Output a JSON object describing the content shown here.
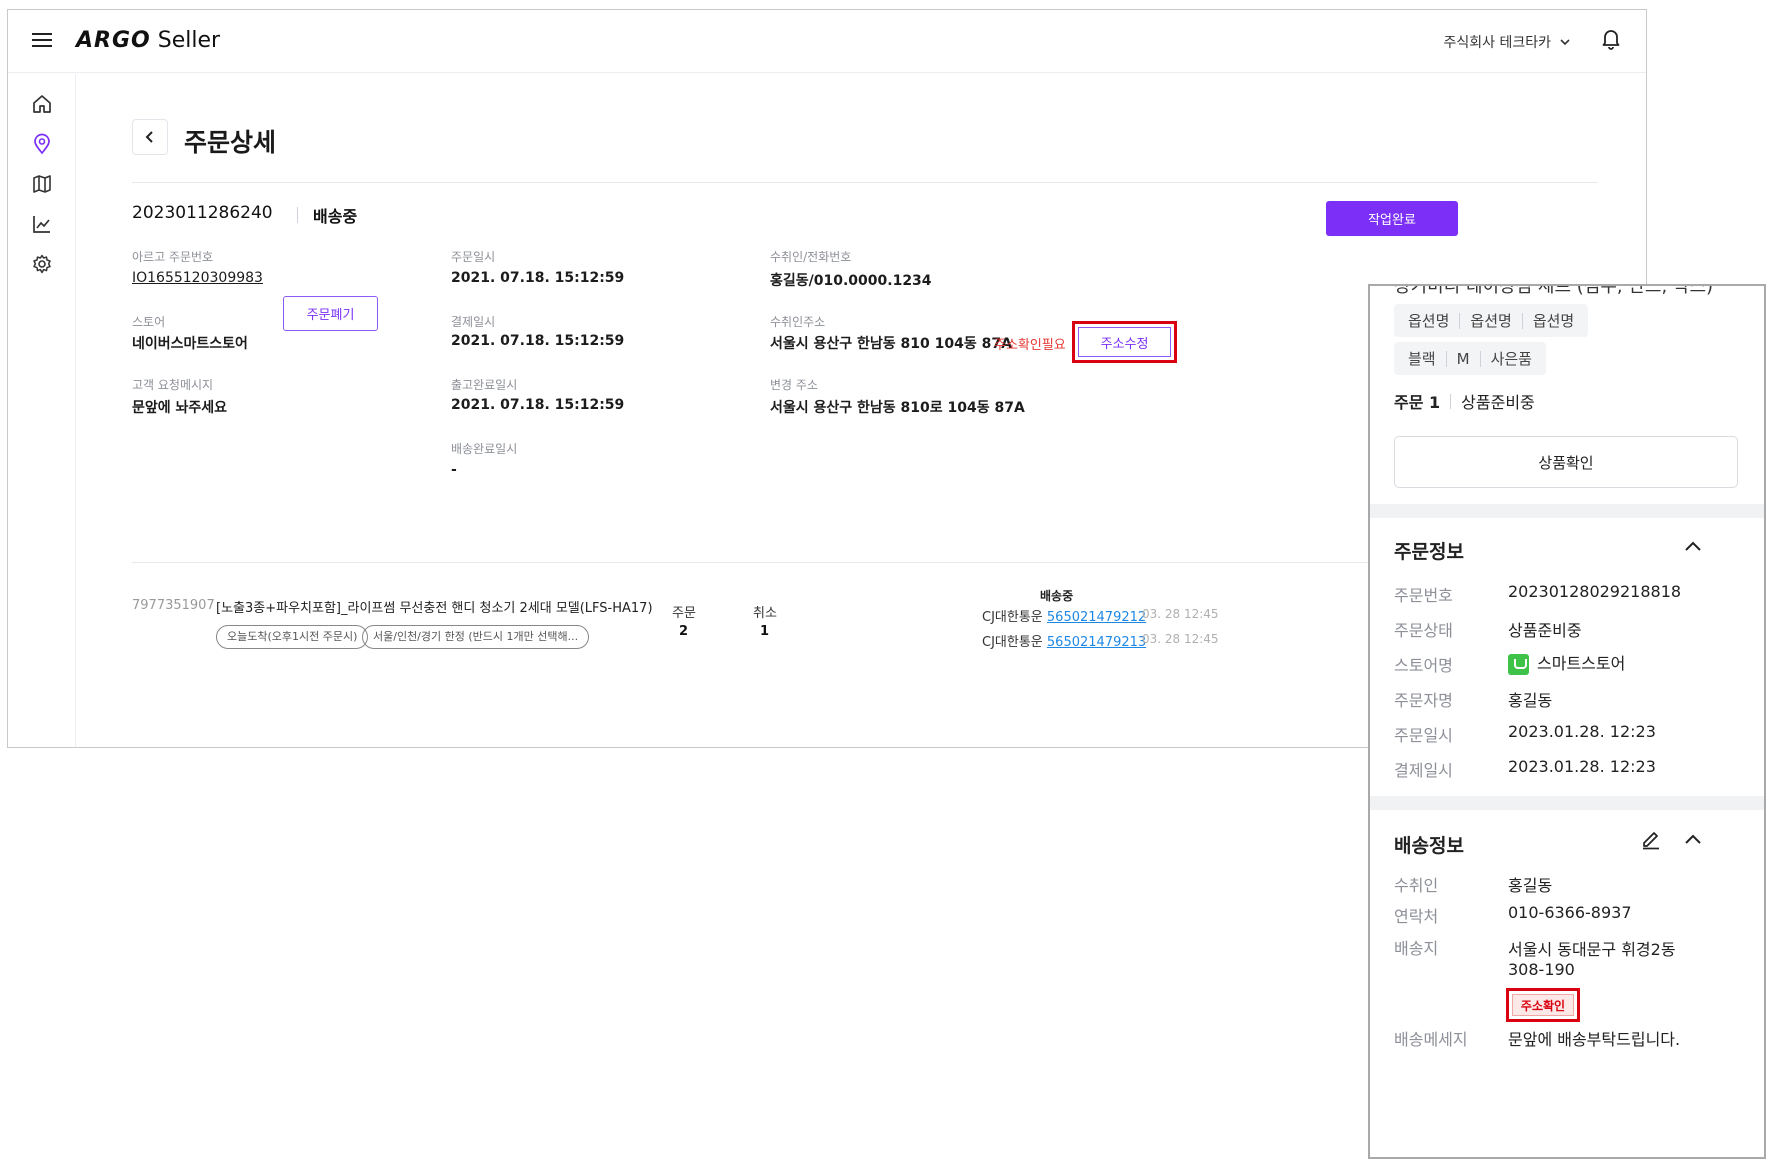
{
  "app": {
    "logo_brand": "ARGO",
    "logo_suffix": "Seller"
  },
  "header": {
    "company": "주식회사 테크타카"
  },
  "page": {
    "title": "주문상세",
    "order_number": "2023011286240",
    "order_status": "배송중",
    "done_button": "작업완료"
  },
  "fields": {
    "argo_no_label": "아르고 주문번호",
    "argo_no_value": "IO1655120309983",
    "cancel_button": "주문폐기",
    "store_label": "스토어",
    "store_value": "네이버스마트스토어",
    "request_label": "고객 요청메시지",
    "request_value": "문앞에 놔주세요",
    "order_date_label": "주문일시",
    "order_date_value": "2021. 07.18. 15:12:59",
    "pay_date_label": "결제일시",
    "pay_date_value": "2021. 07.18. 15:12:59",
    "release_date_label": "출고완료일시",
    "release_date_value": "2021. 07.18. 15:12:59",
    "delivered_date_label": "배송완료일시",
    "delivered_date_value": "-",
    "recipient_label": "수취인/전화번호",
    "recipient_value": "홍길동/010.0000.1234",
    "address_label": "수취인주소",
    "address_value": "서울시 용산구 한남동 810 104동 87A",
    "address_warning": "주소확인필요",
    "address_edit_button": "주소수정",
    "changed_address_label": "변경 주소",
    "changed_address_value": "서울시 용산구 한남동 810로 104동 87A"
  },
  "product": {
    "code": "7977351907",
    "name": "[노출3종+파우치포함]_라이프썸 무선충전 핸디 청소기 2세대 모델(LFS-HA17)",
    "tags": [
      "오늘도착(오후1시전 주문시)",
      "서울/인천/경기 한정 (반드시 1개만 선택해..."
    ],
    "order_label": "주문",
    "order_qty": "2",
    "cancel_label": "취소",
    "cancel_qty": "1",
    "shipping_status": "배송중",
    "shipments": [
      {
        "carrier": "CJ대한통운",
        "tracking": "565021479212",
        "time": "03. 28 12:45"
      },
      {
        "carrier": "CJ대한통운",
        "tracking": "565021479213",
        "time": "03. 28 12:45"
      }
    ]
  },
  "mobile": {
    "cut_title": "장기미디 데이장점 세트 (검수, 안드, 박스)",
    "options_row1": [
      "옵션명",
      "옵션명",
      "옵션명"
    ],
    "options_row2": [
      "블랙",
      "M",
      "사은품"
    ],
    "order_index": "주문 1",
    "order_state": "상품준비중",
    "check_button": "상품확인",
    "order_info": {
      "title": "주문정보",
      "rows": [
        {
          "label": "주문번호",
          "value": "20230128029218818"
        },
        {
          "label": "주문상태",
          "value": "상품준비중"
        },
        {
          "label": "스토어명",
          "value": "스마트스토어"
        },
        {
          "label": "주문자명",
          "value": "홍길동"
        },
        {
          "label": "주문일시",
          "value": "2023.01.28. 12:23"
        },
        {
          "label": "결제일시",
          "value": "2023.01.28. 12:23"
        }
      ]
    },
    "delivery_info": {
      "title": "배송정보",
      "recipient_label": "수취인",
      "recipient_value": "홍길동",
      "phone_label": "연락처",
      "phone_value": "010-6366-8937",
      "address_label": "배송지",
      "address_line1": "서울시 동대문구 휘경2동",
      "address_line2": "308-190",
      "address_confirm_button": "주소확인",
      "message_label": "배송메세지",
      "message_value": "문앞에 배송부탁드립니다."
    }
  },
  "colors": {
    "accent": "#7b2ff7",
    "warning": "#e53935",
    "highlight_box": "#d9000f",
    "link": "#1e88e5",
    "store_green": "#3ec348"
  }
}
